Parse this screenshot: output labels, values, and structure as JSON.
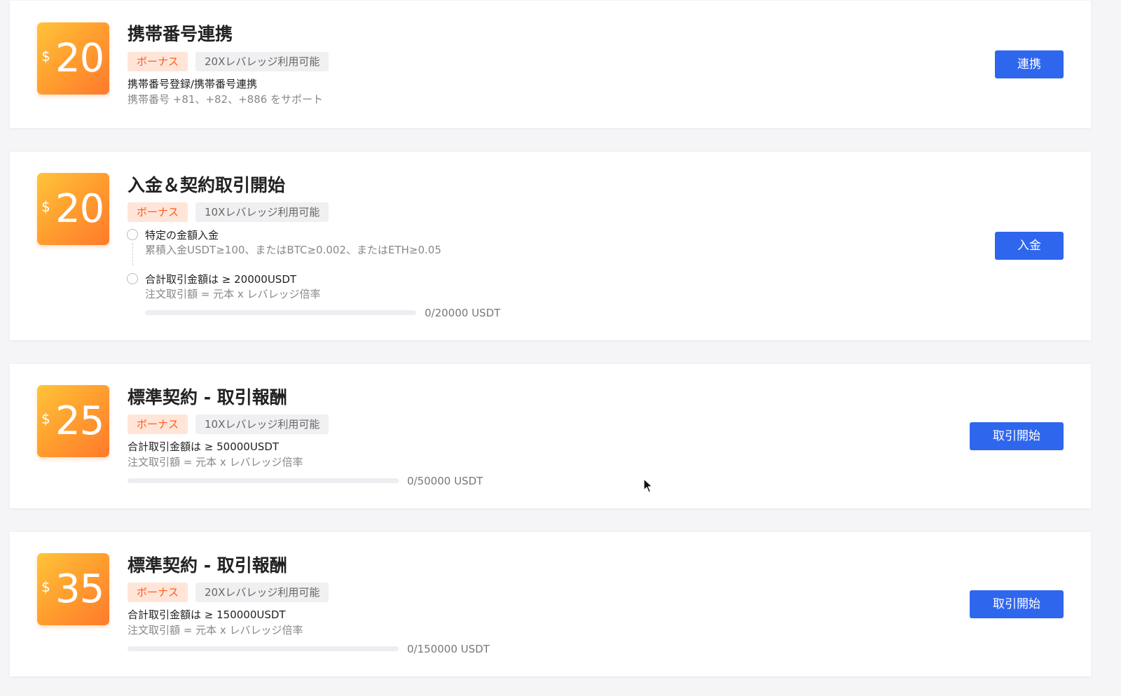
{
  "tasks": [
    {
      "currency_symbol": "$",
      "amount": "20",
      "title": "携帯番号連携",
      "bonus_tag": "ボーナス",
      "leverage_tag": "20Xレバレッジ利用可能",
      "description": "携帯番号登録/携帯番号連携",
      "note": "携帯番号 +81、+82、+886 をサポート",
      "button_label": "連携"
    },
    {
      "currency_symbol": "$",
      "amount": "20",
      "title": "入金＆契約取引開始",
      "bonus_tag": "ボーナス",
      "leverage_tag": "10Xレバレッジ利用可能",
      "steps": [
        {
          "label": "特定の金額入金",
          "note": "累積入金USDT≥100、またはBTC≥0.002、またはETH≥0.05"
        },
        {
          "label": "合計取引金額は ≥ 20000USDT",
          "note": "注文取引額 = 元本 x レバレッジ倍率",
          "progress_text": "0/20000 USDT",
          "progress": 0
        }
      ],
      "button_label": "入金"
    },
    {
      "currency_symbol": "$",
      "amount": "25",
      "title": "標準契約 - 取引報酬",
      "bonus_tag": "ボーナス",
      "leverage_tag": "10Xレバレッジ利用可能",
      "description": "合計取引金額は ≥ 50000USDT",
      "note": "注文取引額 = 元本 x レバレッジ倍率",
      "progress_text": "0/50000 USDT",
      "progress": 0,
      "button_label": "取引開始"
    },
    {
      "currency_symbol": "$",
      "amount": "35",
      "title": "標準契約 - 取引報酬",
      "bonus_tag": "ボーナス",
      "leverage_tag": "20Xレバレッジ利用可能",
      "description": "合計取引金額は ≥ 150000USDT",
      "note": "注文取引額 = 元本 x レバレッジ倍率",
      "progress_text": "0/150000 USDT",
      "progress": 0,
      "button_label": "取引開始"
    }
  ],
  "colors": {
    "accent": "#2f66ee",
    "bonus_text": "#ff5a1e",
    "bonus_bg": "#ffe5d8"
  }
}
